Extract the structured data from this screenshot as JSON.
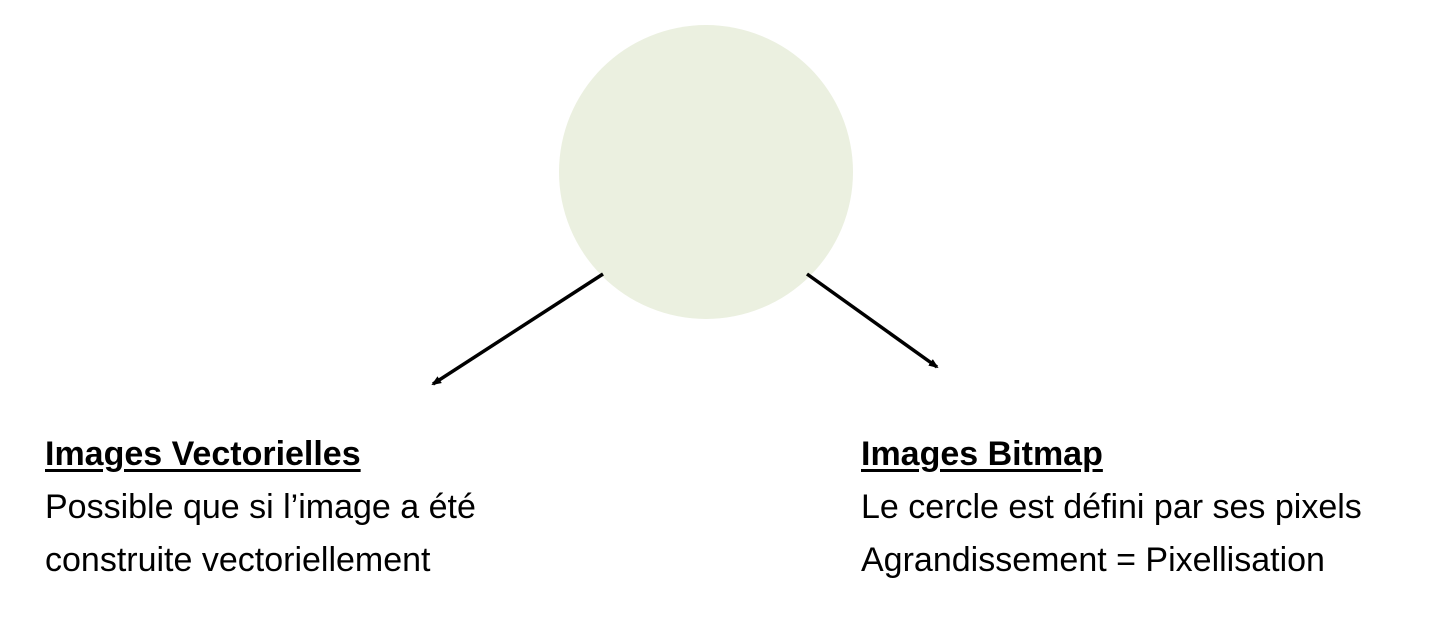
{
  "diagram": {
    "circle_color": "#EBF0E0",
    "arrow_color": "#000000"
  },
  "left": {
    "heading": "Images Vectorielles",
    "line1": "Possible que si l’image a été",
    "line2": "construite vectoriellement"
  },
  "right": {
    "heading": "Images Bitmap",
    "line1": "Le cercle est défini par ses pixels",
    "line2": "Agrandissement = Pixellisation"
  }
}
